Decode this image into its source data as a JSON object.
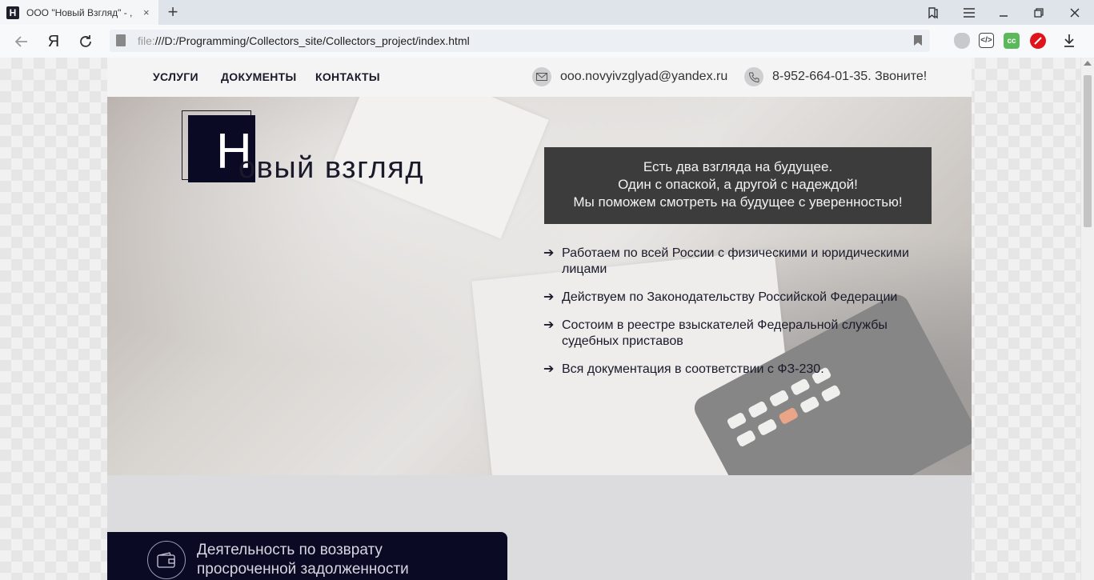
{
  "browser": {
    "tab_title": "ООО \"Новый Взгляд\" - ,",
    "favicon_letter": "Н",
    "tab_close": "×",
    "new_tab": "+",
    "url_scheme": "file:",
    "url_path": "///D:/Programming/Collectors_site/Collectors_project/index.html",
    "yandex_logo": "Я",
    "icons": [
      "back-icon",
      "yandex-icon",
      "reload-icon",
      "doc-icon",
      "bookmark-icon",
      "shield-icon",
      "code-ext-icon",
      "cc-ext-icon",
      "ublock-icon",
      "download-icon",
      "bookmarks-panel-icon",
      "menu-icon",
      "minimize-icon",
      "maximize-icon",
      "close-icon"
    ]
  },
  "header": {
    "nav": [
      "УСЛУГИ",
      "ДОКУМЕНТЫ",
      "КОНТАКТЫ"
    ],
    "email": "ooo.novyivzglyad@yandex.ru",
    "phone": "8-952-664-01-35. Звоните!"
  },
  "hero": {
    "logo_letter": "Н",
    "logo_rest": "овый взгляд",
    "slogan": [
      "Есть два взгляда на будущее.",
      "Один с опаской, а другой с надеждой!",
      "Мы поможем смотреть на будущее с уверенностью!"
    ],
    "features": [
      "Работаем по всей России с физическими и юридическими лицами",
      "Действуем по Законодательству Российской Федерации",
      "Состоим в реестре взыскателей Федеральной службы судебных приставов",
      "Вся документация в соответствии с ФЗ-230."
    ],
    "feature_arrow": "➔"
  },
  "services": {
    "title": "Деятельность по возврату просроченной задолженности"
  },
  "colors": {
    "brand_dark": "#0b0a24",
    "slogan_bg": "#3c3c3c",
    "page_bg": "#dcdcde"
  }
}
